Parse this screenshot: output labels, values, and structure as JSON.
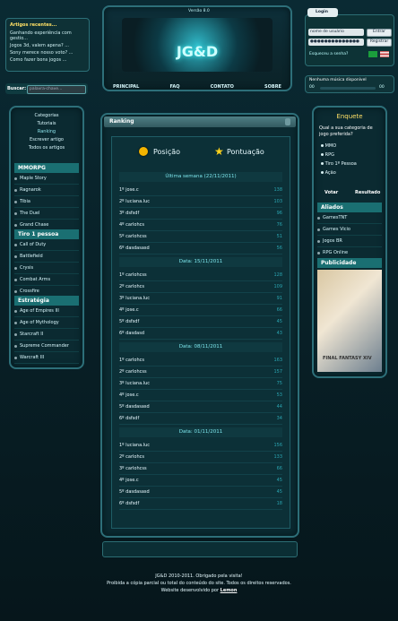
{
  "header": {
    "version": "Versão 8.0",
    "logo": "JG&D",
    "nav": [
      "PRINCIPAL",
      "FAQ",
      "CONTATO",
      "SOBRE"
    ]
  },
  "recent_articles": {
    "title": "Artigos recentes...",
    "items": [
      "Ganhando experiência com gestio...",
      "Jogos 3d, valem apena? ...",
      "Sony merece nosso voto? ...",
      "Como fazer bons jogos ..."
    ]
  },
  "search": {
    "label": "Buscar:",
    "placeholder": "palavra-chave..."
  },
  "login": {
    "tab": "Login",
    "user_placeholder": "nome de usuário",
    "pass_value": "●●●●●●●●●●●●●●",
    "enter": "Entrar",
    "register": "Registrar",
    "forgot": "Esqueceu a senha?"
  },
  "music": {
    "label": "Nenhuma música disponível",
    "time_left": "00",
    "time_right": "00"
  },
  "left_menu": {
    "main_links": [
      "Categorias",
      "Tutoriais",
      "Ranking",
      "Escrever artigo",
      "Todos os artigos"
    ],
    "sections": [
      {
        "title": "MMORPG",
        "items": [
          "Maple Story",
          "Ragnarok",
          "Tibia",
          "The Duel",
          "Grand Chase"
        ]
      },
      {
        "title": "Tiro 1 pessoa",
        "items": [
          "Call of Duty",
          "Battlefield",
          "Crysis",
          "Combat Arms",
          "Crossfire"
        ]
      },
      {
        "title": "Estratégia",
        "items": [
          "Age of Empires III",
          "Age of Mythology",
          "Starcraft II",
          "Supreme Commander",
          "Warcraft III"
        ]
      }
    ]
  },
  "ranking": {
    "title": "Ranking",
    "col_pos": "Posição",
    "col_pts": "Pontuação",
    "groups": [
      {
        "date": "Última semana (22/11/2011)",
        "rows": [
          [
            "1º",
            "jose.c",
            "138"
          ],
          [
            "2º",
            "luciana.luc",
            "103"
          ],
          [
            "3º",
            "dsfsdf",
            "96"
          ],
          [
            "4º",
            "carlohcs",
            "76"
          ],
          [
            "5º",
            "carlohcss",
            "51"
          ],
          [
            "6º",
            "dasdasasd",
            "56"
          ]
        ]
      },
      {
        "date": "Data: 15/11/2011",
        "rows": [
          [
            "1º",
            "carlohcss",
            "128"
          ],
          [
            "2º",
            "carlohcs",
            "109"
          ],
          [
            "3º",
            "luciana.luc",
            "91"
          ],
          [
            "4º",
            "jose.c",
            "66"
          ],
          [
            "5º",
            "dsfsdf",
            "45"
          ],
          [
            "6º",
            "dasdasd",
            "43"
          ]
        ]
      },
      {
        "date": "Data: 08/11/2011",
        "rows": [
          [
            "1º",
            "carlohcs",
            "163"
          ],
          [
            "2º",
            "carlohcss",
            "157"
          ],
          [
            "3º",
            "luciana.luc",
            "75"
          ],
          [
            "4º",
            "jose.c",
            "53"
          ],
          [
            "5º",
            "dasdasasd",
            "44"
          ],
          [
            "6º",
            "dsfsdf",
            "34"
          ]
        ]
      },
      {
        "date": "Data: 01/11/2011",
        "rows": [
          [
            "1º",
            "luciana.luc",
            "156"
          ],
          [
            "2º",
            "carlohcs",
            "133"
          ],
          [
            "3º",
            "carlohcss",
            "66"
          ],
          [
            "4º",
            "jose.c",
            "45"
          ],
          [
            "5º",
            "dasdasasd",
            "45"
          ],
          [
            "6º",
            "dsfsdf",
            "18"
          ]
        ]
      }
    ]
  },
  "poll": {
    "title": "Enquete",
    "question": "Qual a sua categoria de jogo preferida?",
    "options": [
      "MMO",
      "RPG",
      "Tiro 1º Pessoa",
      "Ação"
    ],
    "vote": "Votar",
    "result": "Resultado"
  },
  "allies": {
    "title": "Aliados",
    "items": [
      "GamesTNT",
      "Games Vicio",
      "Jogos BR",
      "RPG Online"
    ]
  },
  "ads": {
    "title": "Publicidade",
    "image_text": "FINAL FANTASY XIV"
  },
  "footer": {
    "line1": "JG&D 2010-2011. Obrigado pela visita!",
    "line2": "Proibida a cópia parcial ou total do conteúdo do site. Todos os direitos reservados.",
    "line3_prefix": "Website desenvolvido por ",
    "author": "Lemon"
  },
  "colors": {
    "bg": "#081a1f",
    "panel": "#0b2a31",
    "accent": "#1a6f72",
    "text_cyan": "#5fd2d8"
  }
}
